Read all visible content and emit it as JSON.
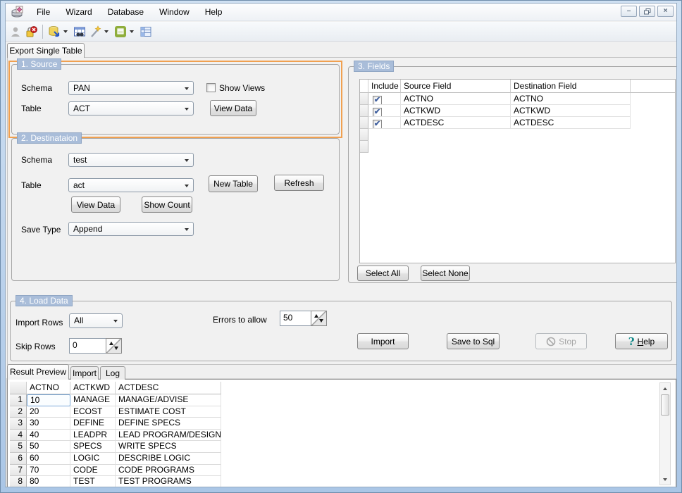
{
  "window": {
    "controls": {
      "minimize_glyph": "–",
      "close_glyph": "×"
    }
  },
  "menu": {
    "items": [
      {
        "label": "File"
      },
      {
        "label": "Wizard"
      },
      {
        "label": "Database"
      },
      {
        "label": "Window"
      },
      {
        "label": "Help"
      }
    ]
  },
  "toolbar": {
    "icons": [
      {
        "name": "user-icon",
        "enabled": false
      },
      {
        "name": "disconnect-key-icon",
        "enabled": true
      },
      {
        "name": "export-database-icon",
        "enabled": true,
        "has_dropdown": true
      },
      {
        "name": "view-table-icon",
        "enabled": true
      },
      {
        "name": "wizard-wand-icon",
        "enabled": true,
        "has_dropdown": true
      },
      {
        "name": "window-cascade-icon",
        "enabled": true,
        "has_dropdown": true
      },
      {
        "name": "grid-list-icon",
        "enabled": true
      }
    ]
  },
  "main_tabs": [
    {
      "label": "Export Single Table",
      "active": true
    }
  ],
  "source": {
    "title": "1. Source",
    "schema_label": "Schema",
    "schema_value": "PAN",
    "table_label": "Table",
    "table_value": "ACT",
    "show_views_label": "Show Views",
    "show_views_checked": false,
    "view_data_label": "View Data"
  },
  "destination": {
    "title": "2. Destinataion",
    "schema_label": "Schema",
    "schema_value": "test",
    "table_label": "Table",
    "table_value": "act",
    "new_table_label": "New Table",
    "refresh_label": "Refresh",
    "view_data_label": "View Data",
    "show_count_label": "Show Count",
    "save_type_label": "Save Type",
    "save_type_value": "Append"
  },
  "fields": {
    "title": "3. Fields",
    "columns": [
      "Include",
      "Source Field",
      "Destination Field"
    ],
    "rows": [
      {
        "include": true,
        "source": "ACTNO",
        "destination": "ACTNO"
      },
      {
        "include": true,
        "source": "ACTKWD",
        "destination": "ACTKWD"
      },
      {
        "include": true,
        "source": "ACTDESC",
        "destination": "ACTDESC"
      }
    ],
    "select_all_label": "Select All",
    "select_none_label": "Select None"
  },
  "load_data": {
    "title": "4. Load Data",
    "import_rows_label": "Import Rows",
    "import_rows_value": "All",
    "skip_rows_label": "Skip Rows",
    "skip_rows_value": "0",
    "errors_label": "Errors to allow",
    "errors_value": "50",
    "import_label": "Import",
    "save_to_sql_label": "Save to Sql",
    "stop_label": "Stop",
    "help_label": "Help"
  },
  "preview": {
    "tabs": [
      {
        "label": "Result Preview",
        "active": true
      },
      {
        "label": "Import",
        "active": false
      },
      {
        "label": "Log",
        "active": false
      }
    ],
    "columns": [
      "ACTNO",
      "ACTKWD",
      "ACTDESC"
    ],
    "rows": [
      {
        "n": "1",
        "actno": "10",
        "actkwd": "MANAGE",
        "actdesc": "MANAGE/ADVISE"
      },
      {
        "n": "2",
        "actno": "20",
        "actkwd": "ECOST",
        "actdesc": "ESTIMATE COST"
      },
      {
        "n": "3",
        "actno": "30",
        "actkwd": "DEFINE",
        "actdesc": "DEFINE SPECS"
      },
      {
        "n": "4",
        "actno": "40",
        "actkwd": "LEADPR",
        "actdesc": "LEAD PROGRAM/DESIGN"
      },
      {
        "n": "5",
        "actno": "50",
        "actkwd": "SPECS",
        "actdesc": "WRITE SPECS"
      },
      {
        "n": "6",
        "actno": "60",
        "actkwd": "LOGIC",
        "actdesc": "DESCRIBE LOGIC"
      },
      {
        "n": "7",
        "actno": "70",
        "actkwd": "CODE",
        "actdesc": "CODE PROGRAMS"
      },
      {
        "n": "8",
        "actno": "80",
        "actkwd": "TEST",
        "actdesc": "TEST PROGRAMS"
      }
    ]
  },
  "colors": {
    "window_border": "#b9d1ec",
    "group_label_bg": "#a9bdd9",
    "highlight_border": "#f0a050",
    "check_color": "#3f5f9e"
  }
}
